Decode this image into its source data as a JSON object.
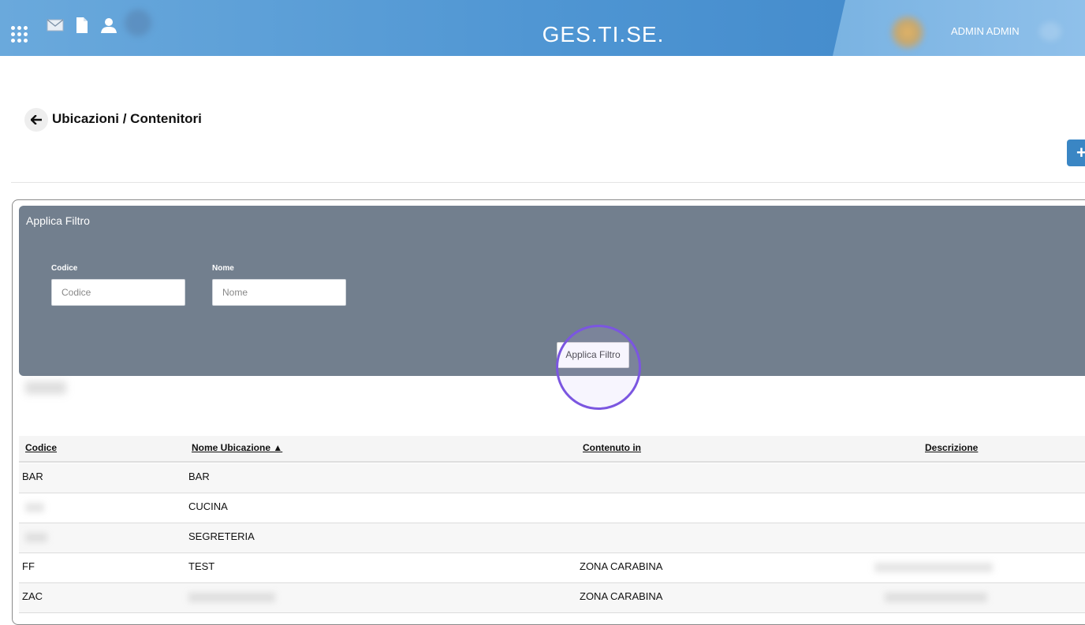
{
  "header": {
    "app_title": "GES.TI.SE.",
    "user_name": "ADMIN ADMIN",
    "icons": [
      "apps-grid-icon",
      "mail-icon",
      "document-icon",
      "user-icon"
    ],
    "colors": {
      "bar": "#4d94d2",
      "bar_right": "#8fc0ea"
    }
  },
  "page": {
    "title": "Ubicazioni / Contenitori",
    "back_icon": "arrow-left-icon",
    "add_button_label": "+"
  },
  "filter": {
    "title": "Applica Filtro",
    "fields": [
      {
        "label": "Codice",
        "placeholder": "Codice",
        "value": ""
      },
      {
        "label": "Nome",
        "placeholder": "Nome",
        "value": ""
      }
    ],
    "apply_label": "Applica Filtro",
    "panel_color": "#727f8e"
  },
  "table": {
    "columns": [
      "Codice",
      "Nome Ubicazione ▲",
      "Contenuto in",
      "Descrizione"
    ],
    "rows": [
      {
        "codice": "BAR",
        "nome": "BAR",
        "contenuto_in": "",
        "descrizione": ""
      },
      {
        "codice": "",
        "nome": "CUCINA",
        "contenuto_in": "",
        "descrizione": ""
      },
      {
        "codice": "",
        "nome": "SEGRETERIA",
        "contenuto_in": "",
        "descrizione": ""
      },
      {
        "codice": "FF",
        "nome": "TEST",
        "contenuto_in": "ZONA CARABINA",
        "descrizione": ""
      },
      {
        "codice": "ZAC",
        "nome": "",
        "contenuto_in": "ZONA CARABINA",
        "descrizione": ""
      }
    ]
  }
}
